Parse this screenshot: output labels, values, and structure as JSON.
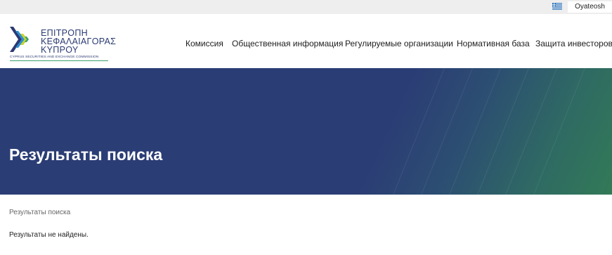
{
  "topbar": {
    "language_flag_icon": "greek-flag-icon",
    "user_label": "Oyateosh"
  },
  "logo": {
    "line1": "ΕΠΙΤΡΟΠΗ",
    "line2": "ΚΕΦΑΛΑΙΑΓΟΡΑΣ",
    "line3": "ΚΥΠΡΟΥ",
    "subtitle": "CYPRUS SECURITIES AND EXCHANGE COMMISSION",
    "colors": {
      "navy": "#2b3a73",
      "green": "#3aa06a",
      "yellow": "#c8d42a",
      "blue": "#2f8fd0"
    }
  },
  "nav": {
    "items": [
      {
        "label": "Комиссия"
      },
      {
        "label": "Общественная информация"
      },
      {
        "label": "Регулируемые организации"
      },
      {
        "label": "Нормативная база"
      },
      {
        "label": "Защита инвесторов"
      }
    ]
  },
  "banner": {
    "title": "Результаты поиска",
    "colors": {
      "start": "#2b3d75",
      "end": "#327a57"
    }
  },
  "breadcrumb": {
    "current": "Результаты поиска"
  },
  "results": {
    "message": "Результаты не найдены."
  }
}
